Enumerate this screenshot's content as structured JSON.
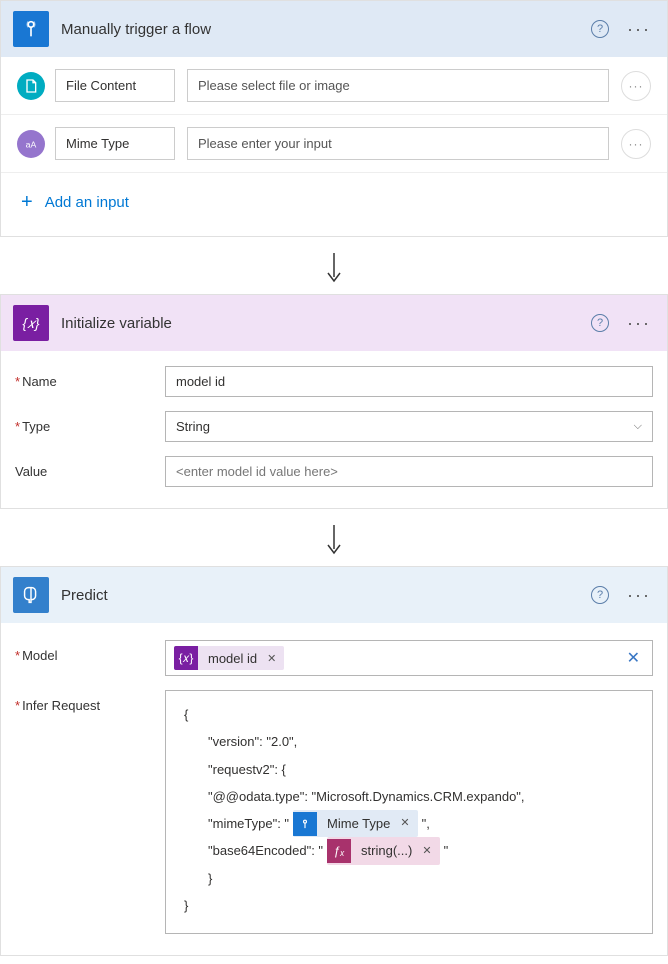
{
  "trigger": {
    "title": "Manually trigger a flow",
    "inputs": [
      {
        "label": "File Content",
        "placeholder": "Please select file or image",
        "icon": "file"
      },
      {
        "label": "Mime Type",
        "placeholder": "Please enter your input",
        "icon": "text"
      }
    ],
    "add_input": "Add an input"
  },
  "variable": {
    "title": "Initialize variable",
    "name_label": "Name",
    "name_value": "model id",
    "type_label": "Type",
    "type_value": "String",
    "value_label": "Value",
    "value_placeholder": "<enter model id value here>"
  },
  "predict": {
    "title": "Predict",
    "model_label": "Model",
    "model_token": "model id",
    "request_label": "Infer Request",
    "code": {
      "l1": "{",
      "l2": "\"version\": \"2.0\",",
      "l3": "\"requestv2\": {",
      "l4": "\"@@odata.type\": \"Microsoft.Dynamics.CRM.expando\",",
      "l5a": "\"mimeType\": \"",
      "l5_token": "Mime Type",
      "l5b": "\",",
      "l6a": "\"base64Encoded\": \"",
      "l6_token": "string(...)",
      "l6b": "\"",
      "l7": "}",
      "l8": "}"
    }
  }
}
